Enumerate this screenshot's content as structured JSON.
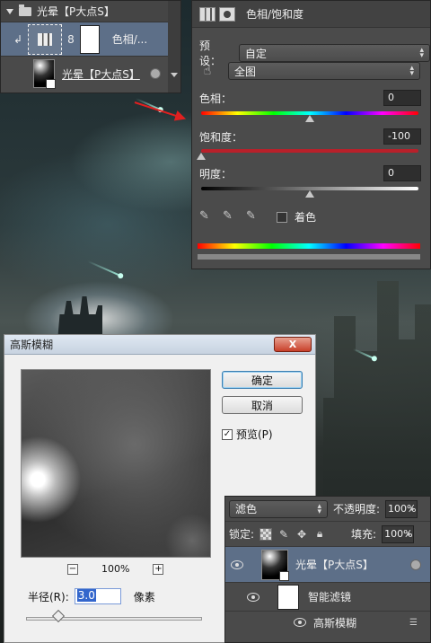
{
  "layers_top": {
    "group_name": "光晕【P大点S】",
    "adjustment_name": "色相/...",
    "layer_name": "光晕【P大点S】"
  },
  "hue_sat": {
    "title": "色相/饱和度",
    "preset_label": "预设：",
    "preset_value": "自定",
    "range_value": "全图",
    "hue_label": "色相：",
    "hue_value": "0",
    "saturation_label": "饱和度：",
    "saturation_value": "-100",
    "lightness_label": "明度：",
    "lightness_value": "0",
    "colorize_label": "着色"
  },
  "gaussian_blur": {
    "title": "高斯模糊",
    "ok_label": "确定",
    "cancel_label": "取消",
    "preview_label": "预览(P)",
    "preview_checked": true,
    "zoom_minus": "−",
    "zoom_level": "100%",
    "zoom_plus": "+",
    "radius_label": "半径(R):",
    "radius_value": "3.0",
    "radius_unit": "像素",
    "close_label": "X"
  },
  "layers_bottom": {
    "blend_mode": "滤色",
    "opacity_label": "不透明度:",
    "opacity_value": "100%",
    "lock_label": "锁定:",
    "fill_label": "填充:",
    "fill_value": "100%",
    "layer_name": "光晕【P大点S】",
    "smart_filters_label": "智能滤镜",
    "filter_name": "高斯模糊"
  },
  "colors": {
    "arrow": "#e02020",
    "selected_layer": "#5d6f88",
    "panel_bg": "#4a4a4a"
  }
}
